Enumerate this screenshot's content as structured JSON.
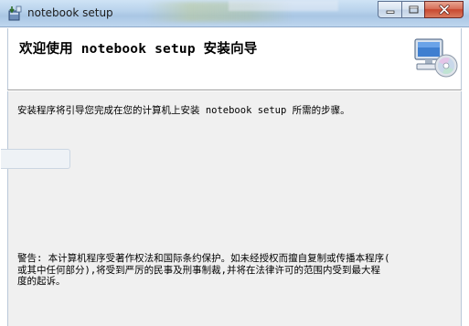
{
  "window": {
    "title": "notebook setup",
    "icon": "installer-package-icon"
  },
  "title_buttons": {
    "minimize_icon": "minimize-icon",
    "maximize_icon": "maximize-icon",
    "close_icon": "close-icon"
  },
  "banner": {
    "title": "欢迎使用 notebook setup 安装向导",
    "icon": "computer-with-cd-icon"
  },
  "body": {
    "intro": "安装程序将引导您完成在您的计算机上安装 notebook setup 所需的步骤。",
    "warning_lines": [
      "警告: 本计算机程序受著作权法和国际条约保护。如未经授权而擅自复制或传播本程序(",
      "或其中任何部分),将受到严厉的民事及刑事制裁,并将在法律许可的范围内受到最大程",
      "度的起诉。"
    ]
  },
  "colors": {
    "titlebar": "#b9d3ec",
    "body_bg": "#f0f0f0",
    "close_button": "#c8482f"
  }
}
